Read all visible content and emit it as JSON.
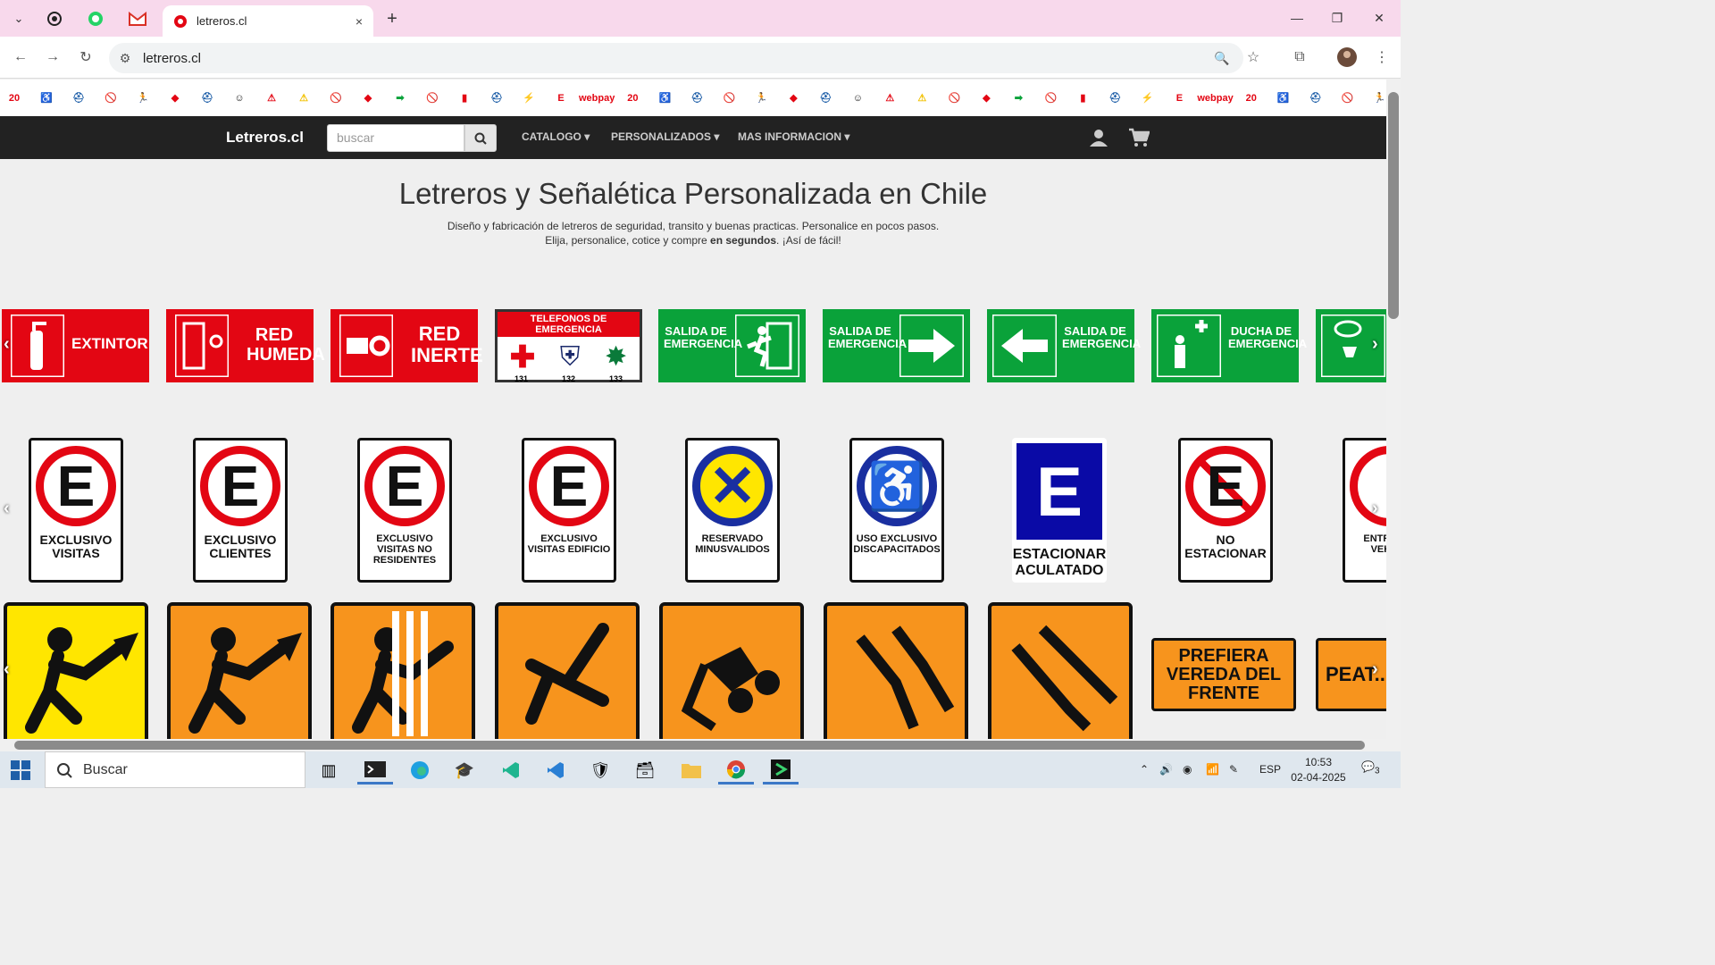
{
  "browser": {
    "tab_title": "letreros.cl",
    "url": "letreros.cl",
    "new_tab": "+",
    "close_tab": "×"
  },
  "icon_strip": [
    "20",
    "♿",
    "⛑",
    "🚫",
    "🏃",
    "◆",
    "⛑",
    "☺",
    "⚠",
    "⚠",
    "🚫",
    "◆",
    "➡",
    "🚫",
    "▮",
    "⛑",
    "⚡",
    "E",
    "webpay"
  ],
  "site": {
    "brand": "Letreros.cl",
    "search_placeholder": "buscar",
    "menu": [
      "CATALOGO ▾",
      "PERSONALIZADOS ▾",
      "MAS INFORMACION ▾"
    ]
  },
  "hero": {
    "title": "Letreros y Señalética Personalizada en Chile",
    "line1": "Diseño y fabricación de letreros de seguridad, transito y buenas practicas. Personalice en pocos pasos.",
    "line2_a": "Elija, personalice, cotice y compre ",
    "line2_bold": "en segundos",
    "line2_b": ". ¡Así de fácil!"
  },
  "row1": [
    {
      "label": "EXTINTOR",
      "color": "red"
    },
    {
      "label": "RED HUMEDA",
      "color": "red"
    },
    {
      "label": "RED INERTE",
      "color": "red"
    },
    {
      "label": "TELEFONOS DE EMERGENCIA",
      "color": "white",
      "numbers": [
        "131",
        "132",
        "133"
      ]
    },
    {
      "label": "SALIDA DE EMERGENCIA",
      "color": "green"
    },
    {
      "label": "SALIDA DE EMERGENCIA",
      "color": "green"
    },
    {
      "label": "SALIDA DE EMERGENCIA",
      "color": "green"
    },
    {
      "label": "DUCHA DE EMERGENCIA",
      "color": "green"
    }
  ],
  "row2": [
    {
      "letter": "E",
      "label": "EXCLUSIVO VISITAS"
    },
    {
      "letter": "E",
      "label": "EXCLUSIVO CLIENTES"
    },
    {
      "letter": "E",
      "label": "EXCLUSIVO VISITAS NO RESIDENTES"
    },
    {
      "letter": "E",
      "label": "EXCLUSIVO VISITAS EDIFICIO"
    },
    {
      "letter": "",
      "label": "RESERVADO MINUSVALIDOS"
    },
    {
      "letter": "♿",
      "label": "USO EXCLUSIVO DISCAPACITADOS"
    },
    {
      "letter": "E",
      "label": "ESTACIONAR ACULATADO"
    },
    {
      "letter": "E",
      "label": "NO ESTACIONAR"
    },
    {
      "letter": "",
      "label": "ENTR... D... VEHIC..."
    }
  ],
  "row3": [
    {
      "label": "PREFIERA VEREDA DEL FRENTE"
    },
    {
      "label": "PEAT..."
    }
  ],
  "taskbar": {
    "search": "Buscar",
    "lang": "ESP",
    "time": "10:53",
    "date": "02-04-2025",
    "notifications": "3"
  },
  "colors": {
    "tab_strip": "#f8d9ec",
    "nav_bg": "#222222",
    "sign_red": "#e30613",
    "sign_green": "#0aa23a",
    "sign_orange": "#f7941d",
    "sign_yellow": "#ffe600"
  }
}
